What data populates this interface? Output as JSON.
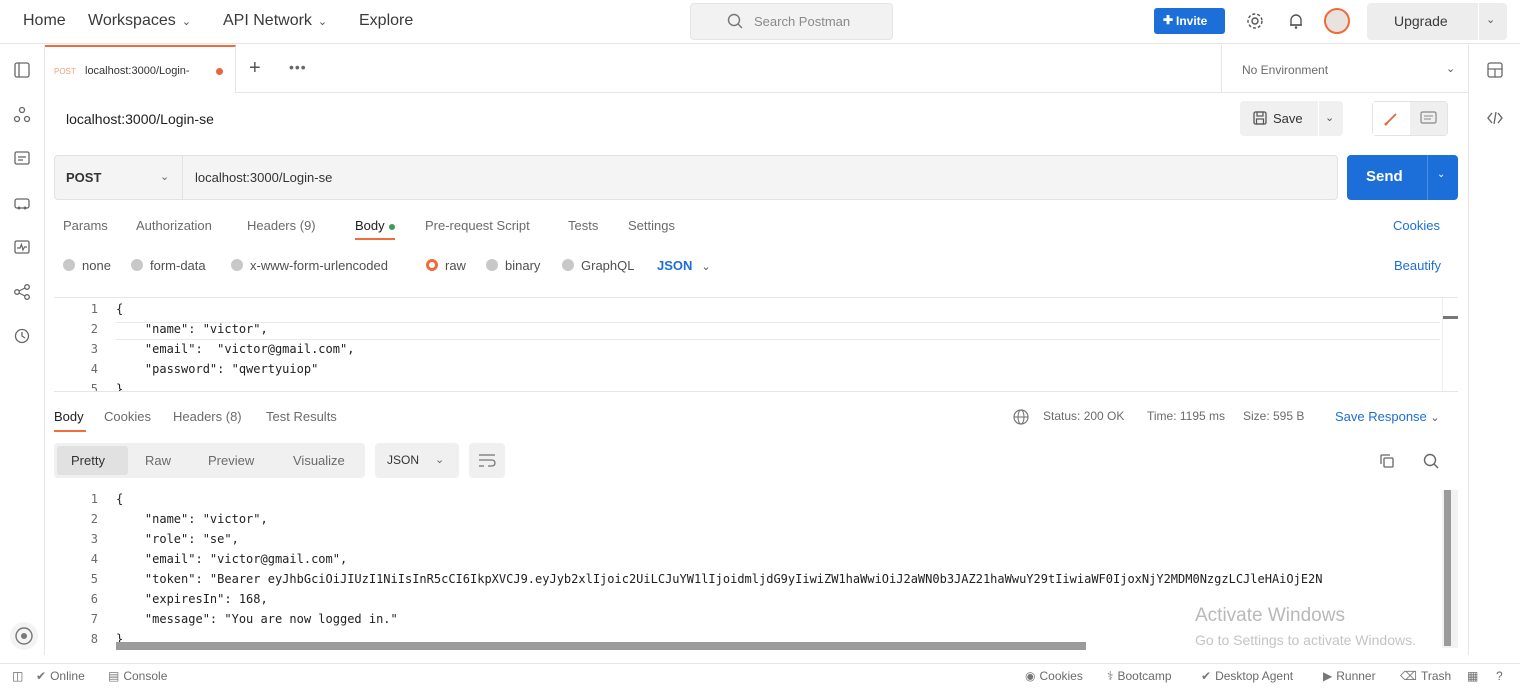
{
  "topbar": {
    "home": "Home",
    "workspaces": "Workspaces",
    "api_network": "API Network",
    "explore": "Explore",
    "search_placeholder": "Search Postman",
    "invite": "Invite",
    "upgrade": "Upgrade"
  },
  "tabs": {
    "active_method": "POST",
    "active_name": "localhost:3000/Login-",
    "environment": "No Environment"
  },
  "request": {
    "title": "localhost:3000/Login-se",
    "save": "Save",
    "method": "POST",
    "url": "localhost:3000/Login-se",
    "send": "Send",
    "tabs": [
      "Params",
      "Authorization",
      "Headers (9)",
      "Body",
      "Pre-request Script",
      "Tests",
      "Settings"
    ],
    "cookies": "Cookies",
    "body_types": [
      "none",
      "form-data",
      "x-www-form-urlencoded",
      "raw",
      "binary",
      "GraphQL"
    ],
    "body_format": "JSON",
    "beautify": "Beautify",
    "line_numbers": [
      "1",
      "2",
      "3",
      "4",
      "5"
    ],
    "body_lines": [
      "{",
      "    \"name\": \"victor\",",
      "    \"email\":  \"victor@gmail.com\",",
      "    \"password\": \"qwertyuiop\"",
      "}"
    ]
  },
  "response": {
    "tabs": [
      "Body",
      "Cookies",
      "Headers (8)",
      "Test Results"
    ],
    "status": "Status: 200 OK",
    "time": "Time: 1195 ms",
    "size": "Size: 595 B",
    "save_response": "Save Response",
    "view_modes": [
      "Pretty",
      "Raw",
      "Preview",
      "Visualize"
    ],
    "format": "JSON",
    "line_numbers": [
      "1",
      "2",
      "3",
      "4",
      "5",
      "6",
      "7",
      "8"
    ],
    "body_lines": [
      "{",
      "    \"name\": \"victor\",",
      "    \"role\": \"se\",",
      "    \"email\": \"victor@gmail.com\",",
      "    \"token\": \"Bearer eyJhbGciOiJIUzI1NiIsInR5cCI6IkpXVCJ9.eyJyb2xlIjoic2UiLCJuYW1lIjoidmljdG9yIiwiZW1haWwiOiJ2aWN0b3JAZ21haWwuY29tIiwiaWF0IjoxNjY2MDM0NzgzLCJleHAiOjE2N",
      "    \"expiresIn\": 168,",
      "    \"message\": \"You are now logged in.\"",
      "}"
    ]
  },
  "watermark": {
    "title": "Activate Windows",
    "subtitle": "Go to Settings to activate Windows."
  },
  "statusbar": {
    "online": "Online",
    "console": "Console",
    "cookies": "Cookies",
    "bootcamp": "Bootcamp",
    "desktop_agent": "Desktop Agent",
    "runner": "Runner",
    "trash": "Trash"
  },
  "colors": {
    "accent_orange": "#f26b3a",
    "primary_blue": "#1c6fd8"
  }
}
